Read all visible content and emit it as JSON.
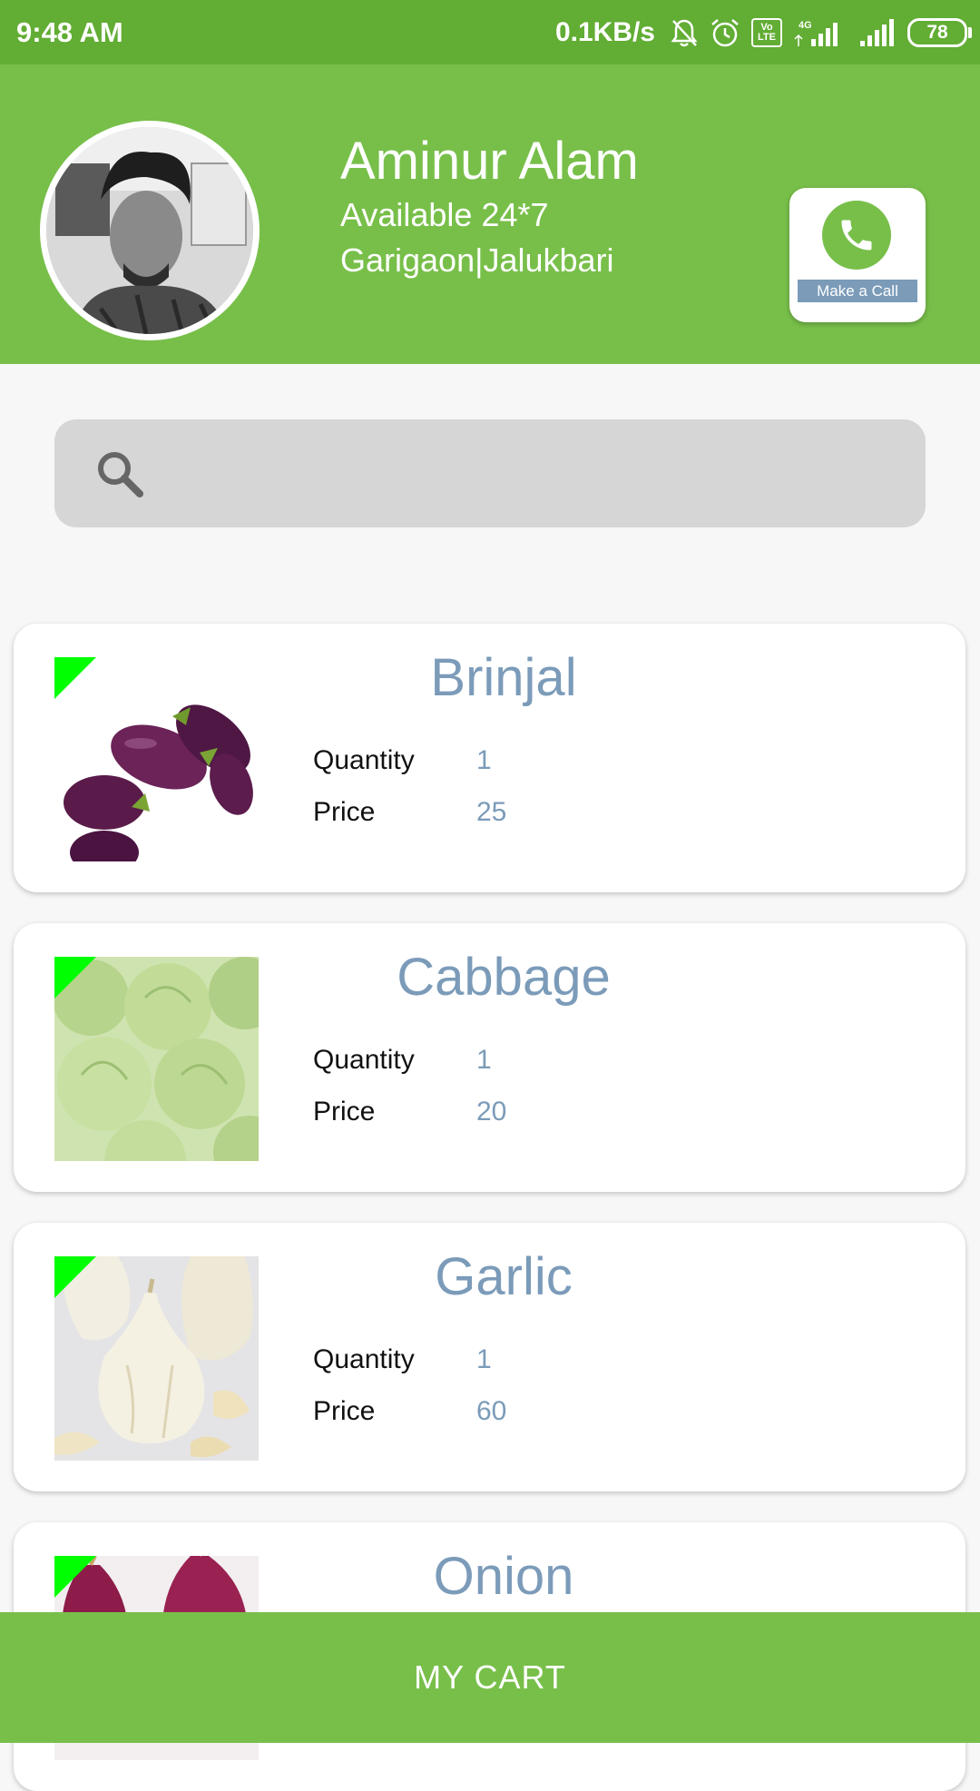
{
  "status_bar": {
    "time": "9:48 AM",
    "speed": "0.1KB/s",
    "network": "4G",
    "volte": "Vo LTE",
    "battery": "78"
  },
  "profile": {
    "name": "Aminur Alam",
    "availability": "Available 24*7",
    "location": "Garigaon|Jalukbari",
    "call_label": "Make a Call"
  },
  "search": {
    "placeholder": ""
  },
  "labels": {
    "quantity": "Quantity",
    "price": "Price"
  },
  "products": [
    {
      "name": "Brinjal",
      "quantity": "1",
      "price": "25"
    },
    {
      "name": "Cabbage",
      "quantity": "1",
      "price": "20"
    },
    {
      "name": "Garlic",
      "quantity": "1",
      "price": "60"
    },
    {
      "name": "Onion"
    }
  ],
  "cart": {
    "label": "MY CART"
  },
  "colors": {
    "status_bar": "#62ad34",
    "header": "#78bf4a",
    "accent_text": "#7b9bb9",
    "badge": "#00ff00"
  }
}
